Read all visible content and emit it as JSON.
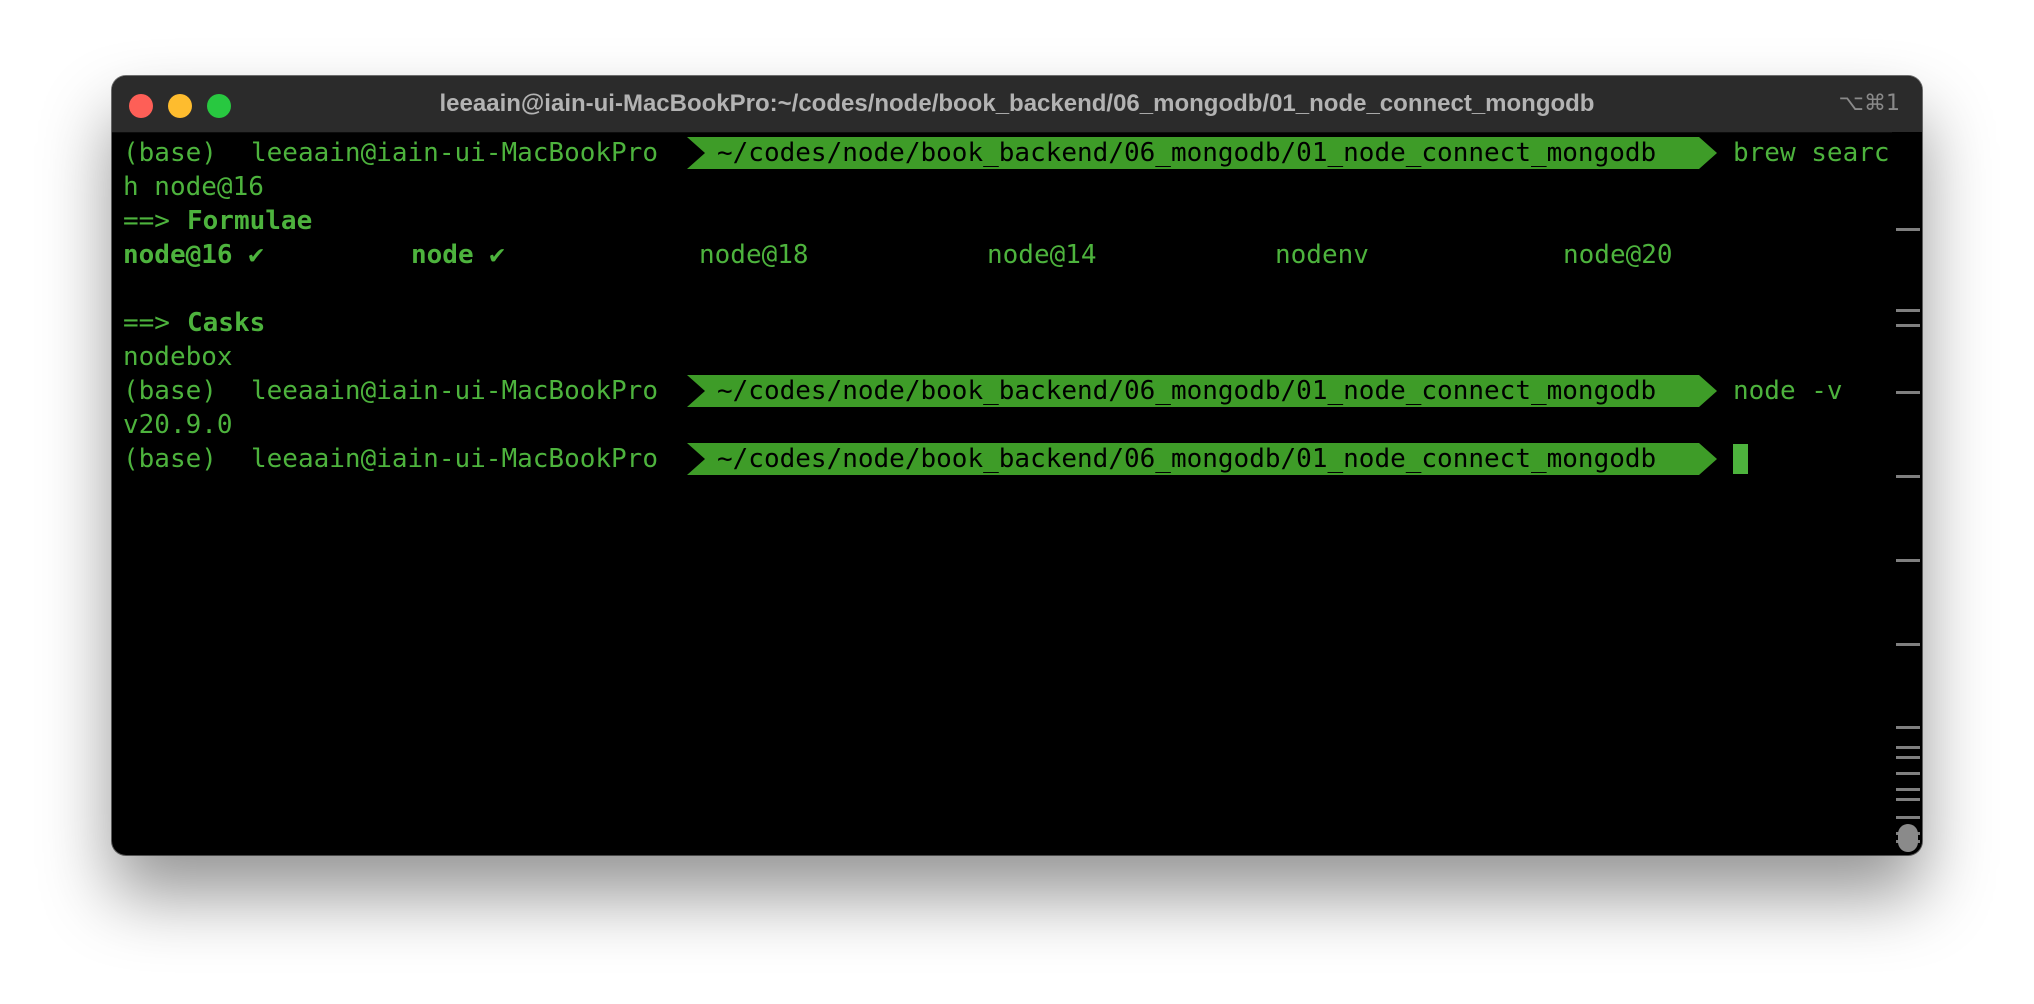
{
  "window": {
    "title": "leeaain@iain-ui-MacBookPro:~/codes/node/book_backend/06_mongodb/01_node_connect_mongodb",
    "shortcut": "⌥⌘1",
    "colors": {
      "terminal_fg": "#4db33d",
      "prompt_bg": "#3e9c28",
      "background": "#000000",
      "titlebar": "#2b2b2b",
      "close": "#fe5f57",
      "minimize": "#febc2e",
      "zoom": "#28c840"
    }
  },
  "terminal": {
    "prompt": {
      "env": "(base)",
      "user_host": "leeaain@iain-ui-MacBookPro",
      "path": "~/codes/node/book_backend/06_mongodb/01_node_connect_mongodb"
    },
    "commands": [
      {
        "text": "brew searc",
        "wrap": "h node@16"
      },
      {
        "text": "node -v"
      }
    ],
    "formulae_header": {
      "arrow": "==>",
      "label": "Formulae"
    },
    "formulae": [
      {
        "name": "node@16 ✔",
        "installed": true
      },
      {
        "name": "node ✔",
        "installed": true
      },
      {
        "name": "node@18",
        "installed": false
      },
      {
        "name": "node@14",
        "installed": false
      },
      {
        "name": "nodenv",
        "installed": false
      },
      {
        "name": "node@20",
        "installed": false
      }
    ],
    "casks_header": {
      "arrow": "==>",
      "label": "Casks"
    },
    "casks": [
      "nodebox"
    ],
    "node_version_output": "v20.9.0"
  }
}
